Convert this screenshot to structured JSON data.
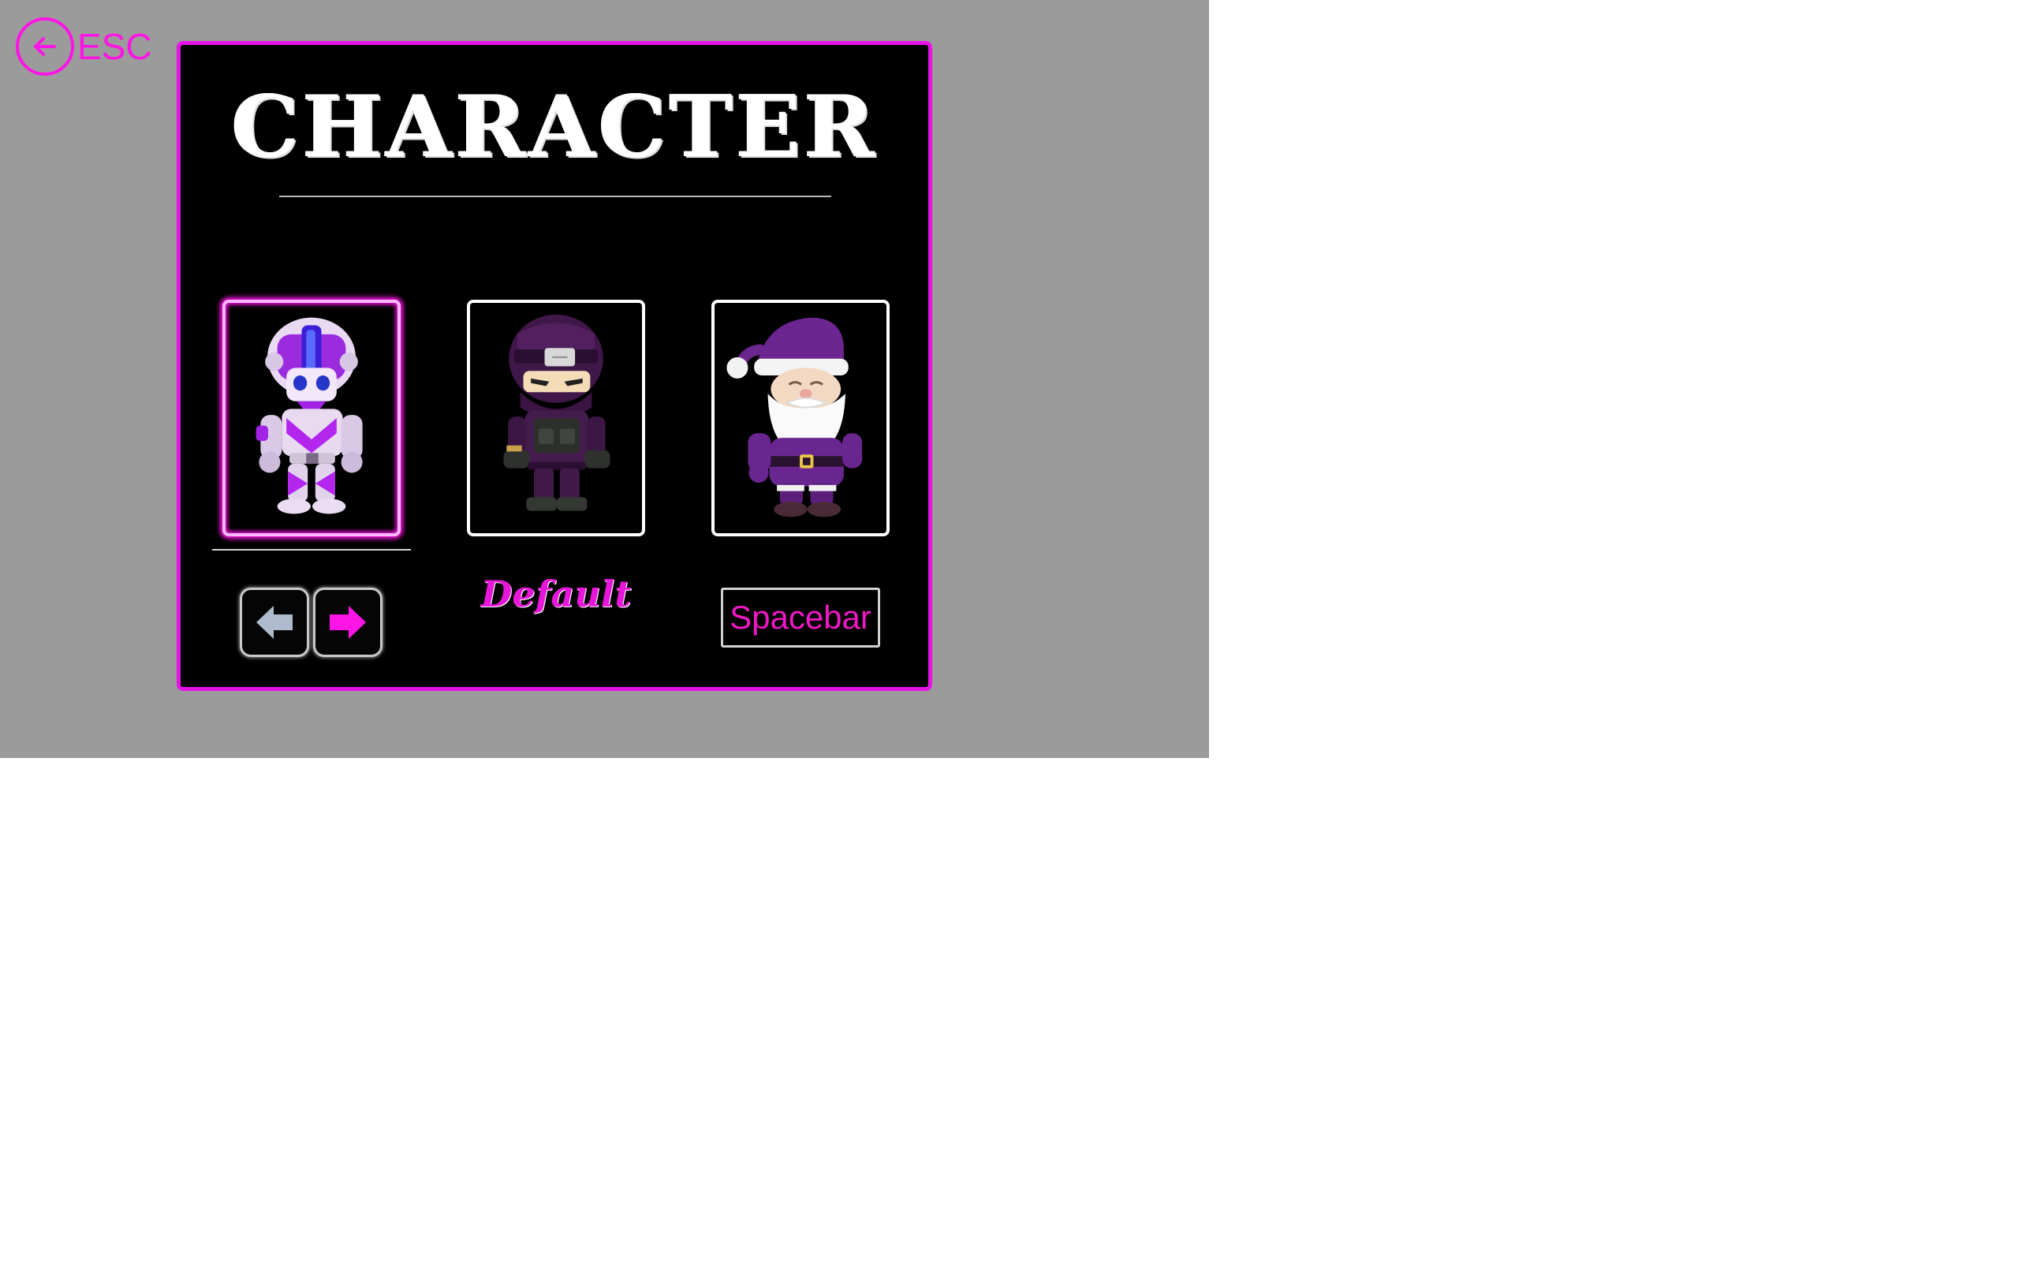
{
  "screen": {
    "title": "CHARACTER",
    "esc": {
      "label": "ESC",
      "icon": "arrow-left-circle-icon"
    },
    "characters": [
      {
        "id": "robot",
        "icon": "robot-character-icon",
        "selected": true
      },
      {
        "id": "ninja",
        "icon": "ninja-character-icon",
        "selected": false
      },
      {
        "id": "santa",
        "icon": "santa-character-icon",
        "selected": false
      }
    ],
    "controls": {
      "left_icon": "arrow-left-key-icon",
      "right_icon": "arrow-right-key-icon",
      "default_label": "Default",
      "spacebar_label": "Spacebar"
    }
  },
  "colors": {
    "background": "#9b9b9b",
    "panel": "#000000",
    "accent": "#e713e6",
    "title": "#ffffff",
    "spacebar_text": "#f019c5",
    "arrow_left": "#aebbcc",
    "arrow_right": "#ff14e6"
  }
}
